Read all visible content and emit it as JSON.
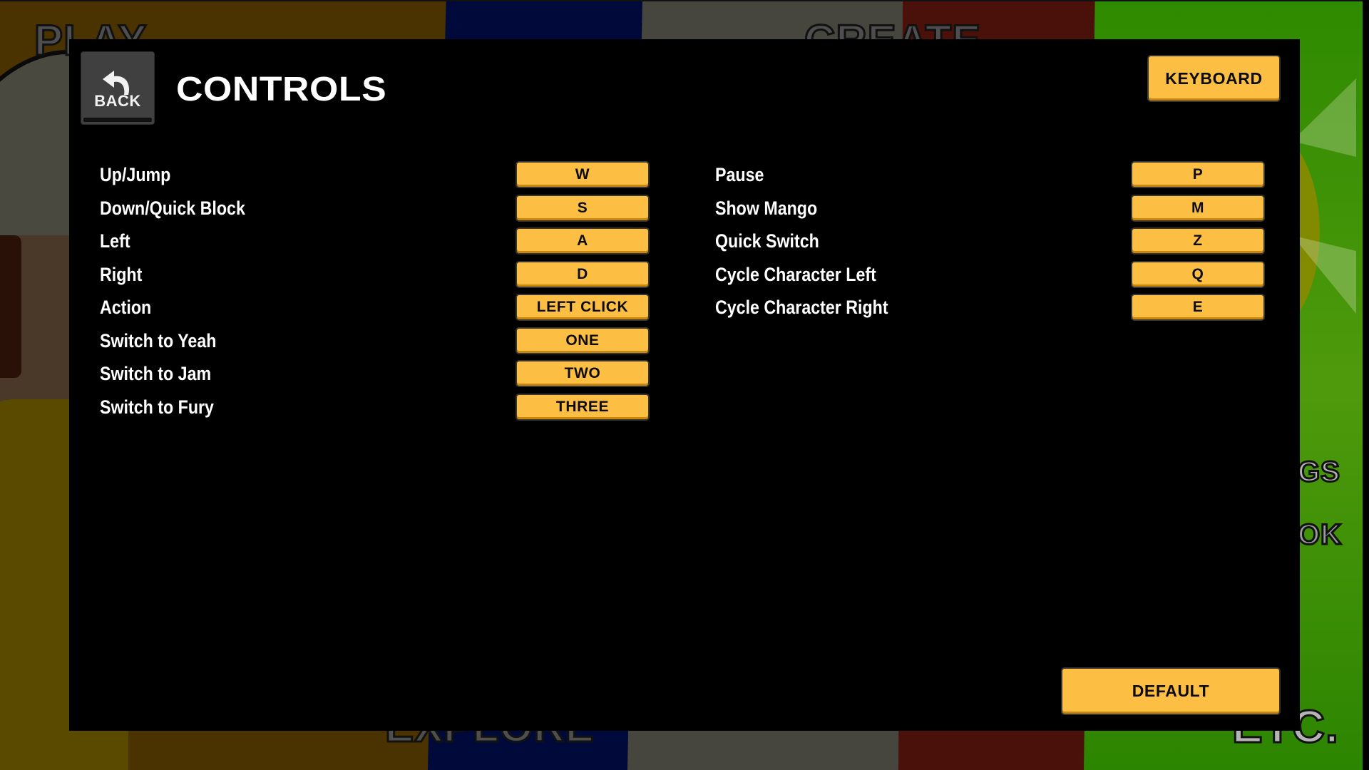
{
  "background": {
    "menu_labels": {
      "play": "PLAY",
      "create": "CREATE",
      "explore": "EXPLORE",
      "settings_partial": "GS",
      "book_partial": "OK",
      "etc": "ETC."
    }
  },
  "header": {
    "back_label": "BACK",
    "back_icon": "curved-back-arrow-icon",
    "title": "CONTROLS",
    "input_device_button": "KEYBOARD"
  },
  "bindings": {
    "left": [
      {
        "action": "Up/Jump",
        "key": "W"
      },
      {
        "action": "Down/Quick Block",
        "key": "S"
      },
      {
        "action": "Left",
        "key": "A"
      },
      {
        "action": "Right",
        "key": "D"
      },
      {
        "action": "Action",
        "key": "LEFT CLICK"
      },
      {
        "action": "Switch to Yeah",
        "key": "ONE"
      },
      {
        "action": "Switch to Jam",
        "key": "TWO"
      },
      {
        "action": "Switch to Fury",
        "key": "THREE"
      }
    ],
    "right": [
      {
        "action": "Pause",
        "key": "P"
      },
      {
        "action": "Show Mango",
        "key": "M"
      },
      {
        "action": "Quick Switch",
        "key": "Z"
      },
      {
        "action": "Cycle Character Left",
        "key": "Q"
      },
      {
        "action": "Cycle Character Right",
        "key": "E"
      }
    ]
  },
  "footer": {
    "default_button": "DEFAULT"
  },
  "colors": {
    "button_fill": "#fdbe44",
    "button_shadow": "#c98710",
    "panel_bg": "#000000",
    "back_button_bg": "#404040"
  }
}
